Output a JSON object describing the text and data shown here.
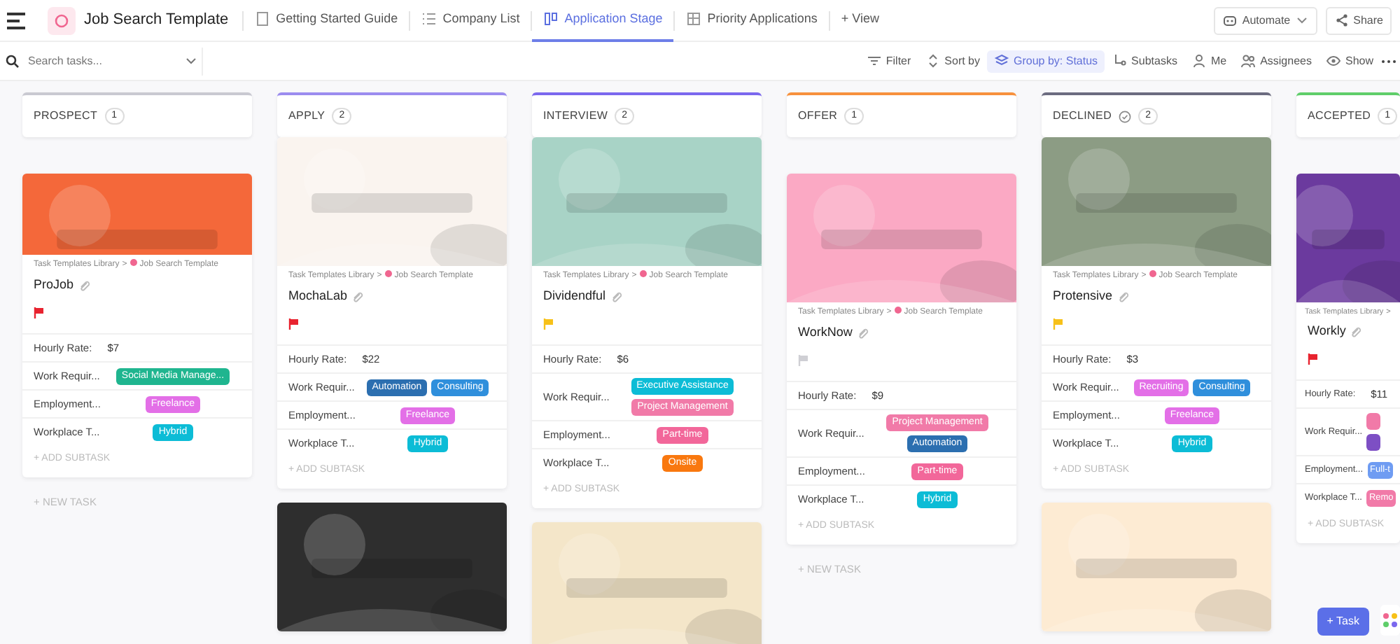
{
  "header": {
    "title": "Job Search Template"
  },
  "tabs": [
    {
      "label": "Getting Started Guide",
      "selected": false
    },
    {
      "label": "Company List",
      "selected": false
    },
    {
      "label": "Application Stage",
      "selected": true
    },
    {
      "label": "Priority Applications",
      "selected": false
    }
  ],
  "add_view": "+ View",
  "actions": [
    {
      "label": "Automate",
      "caret": true
    },
    {
      "label": "Share",
      "caret": false
    }
  ],
  "search": {
    "placeholder": "Search tasks..."
  },
  "toolbar": [
    {
      "label": "Filter",
      "selected": false
    },
    {
      "label": "Sort by",
      "selected": false
    },
    {
      "label": "Group by: Status",
      "selected": true
    },
    {
      "label": "Subtasks",
      "selected": false
    },
    {
      "label": "Me",
      "selected": false
    },
    {
      "label": "Assignees",
      "selected": false
    },
    {
      "label": "Show",
      "selected": false
    }
  ],
  "columns": [
    {
      "name": "PROSPECT",
      "count": "1",
      "color": "#c9c9d1",
      "closed": false,
      "new_task": "+ NEW TASK",
      "cards": [
        {
          "cover": {
            "kind": "picture",
            "color": "#f4683a"
          },
          "library": "Task Templates Library",
          "separator": ">",
          "template": "Job Search Template",
          "title": "ProJob",
          "flag": {
            "color": "#e8232f"
          },
          "fields": [
            {
              "label": "Hourly Rate:",
              "value": "$7"
            },
            {
              "label": "Work Requir...",
              "tags": [
                {
                  "text": "Social Media Manage...",
                  "color": "#1fb58f"
                }
              ]
            },
            {
              "label": "Employment...",
              "tags": [
                {
                  "text": "Freelance",
                  "color": "#e36fe7"
                }
              ]
            },
            {
              "label": "Workplace T...",
              "tags": [
                {
                  "text": "Hybrid",
                  "color": "#0cbcd6"
                }
              ]
            }
          ],
          "add_subtask": "+ ADD SUBTASK"
        }
      ]
    },
    {
      "name": "APPLY",
      "count": "2",
      "color": "#9b8cef",
      "closed": false,
      "cards": [
        {
          "cover": {
            "kind": "picture",
            "color": "#faf4ef"
          },
          "library": "Task Templates Library",
          "separator": ">",
          "template": "Job Search Template",
          "title": "MochaLab",
          "flag": {
            "color": "#e8232f"
          },
          "fields": [
            {
              "label": "Hourly Rate:",
              "value": "$22"
            },
            {
              "label": "Work Requir...",
              "tags": [
                {
                  "text": "Automation",
                  "color": "#2c6fb0"
                },
                {
                  "text": "Consulting",
                  "color": "#2f8fdc"
                }
              ]
            },
            {
              "label": "Employment...",
              "tags": [
                {
                  "text": "Freelance",
                  "color": "#e36fe7"
                }
              ]
            },
            {
              "label": "Workplace T...",
              "tags": [
                {
                  "text": "Hybrid",
                  "color": "#0cbcd6"
                }
              ]
            }
          ],
          "add_subtask": "+ ADD SUBTASK"
        },
        {
          "cover": {
            "kind": "picture",
            "color": "#2e2e2e"
          }
        }
      ]
    },
    {
      "name": "INTERVIEW",
      "count": "2",
      "color": "#7b68ee",
      "closed": false,
      "cards": [
        {
          "cover": {
            "kind": "picture",
            "color": "#a8d3c6"
          },
          "library": "Task Templates Library",
          "separator": ">",
          "template": "Job Search Template",
          "title": "Dividendful",
          "flag": {
            "color": "#f7c118"
          },
          "fields": [
            {
              "label": "Hourly Rate:",
              "value": "$6"
            },
            {
              "label": "Work Requir...",
              "tags": [
                {
                  "text": "Executive Assistance",
                  "color": "#0cbcd6"
                },
                {
                  "text": "Project Management",
                  "color": "#f17aa8"
                }
              ]
            },
            {
              "label": "Employment...",
              "tags": [
                {
                  "text": "Part-time",
                  "color": "#f2679a"
                }
              ]
            },
            {
              "label": "Workplace T...",
              "tags": [
                {
                  "text": "Onsite",
                  "color": "#f9780f"
                }
              ]
            }
          ],
          "add_subtask": "+ ADD SUBTASK"
        },
        {
          "cover": {
            "kind": "picture",
            "color": "#f4e6c9"
          }
        }
      ]
    },
    {
      "name": "OFFER",
      "count": "1",
      "color": "#f7913d",
      "closed": false,
      "new_task": "+ NEW TASK",
      "cards": [
        {
          "cover": {
            "kind": "picture",
            "color": "#fba9c4"
          },
          "library": "Task Templates Library",
          "separator": ">",
          "template": "Job Search Template",
          "title": "WorkNow",
          "flag": {
            "color": "#cfcfd4"
          },
          "fields": [
            {
              "label": "Hourly Rate:",
              "value": "$9"
            },
            {
              "label": "Work Requir...",
              "tags": [
                {
                  "text": "Project Management",
                  "color": "#f17aa8"
                },
                {
                  "text": "Automation",
                  "color": "#2c6fb0"
                }
              ]
            },
            {
              "label": "Employment...",
              "tags": [
                {
                  "text": "Part-time",
                  "color": "#f2679a"
                }
              ]
            },
            {
              "label": "Workplace T...",
              "tags": [
                {
                  "text": "Hybrid",
                  "color": "#0cbcd6"
                }
              ]
            }
          ],
          "add_subtask": "+ ADD SUBTASK"
        }
      ]
    },
    {
      "name": "DECLINED",
      "count": "2",
      "color": "#6c6c80",
      "closed": true,
      "cards": [
        {
          "cover": {
            "kind": "picture",
            "color": "#8c9c84"
          },
          "library": "Task Templates Library",
          "separator": ">",
          "template": "Job Search Template",
          "title": "Protensive",
          "flag": {
            "color": "#f7c118"
          },
          "fields": [
            {
              "label": "Hourly Rate:",
              "value": "$3"
            },
            {
              "label": "Work Requir...",
              "tags": [
                {
                  "text": "Recruiting",
                  "color": "#e36fe7"
                },
                {
                  "text": "Consulting",
                  "color": "#2f8fdc"
                }
              ]
            },
            {
              "label": "Employment...",
              "tags": [
                {
                  "text": "Freelance",
                  "color": "#e36fe7"
                }
              ]
            },
            {
              "label": "Workplace T...",
              "tags": [
                {
                  "text": "Hybrid",
                  "color": "#0cbcd6"
                }
              ]
            }
          ],
          "add_subtask": "+ ADD SUBTASK"
        },
        {
          "cover": {
            "kind": "picture",
            "color": "#fdebd3"
          }
        }
      ]
    },
    {
      "name": "ACCEPTED",
      "count": "1",
      "color": "#5fce6a",
      "closed": false,
      "cards": [
        {
          "cover": {
            "kind": "picture",
            "color": "#6b3a9e"
          },
          "library": "Task Templates Library",
          "separator": ">",
          "title": "Workly",
          "flag": {
            "color": "#e8232f"
          },
          "fields": [
            {
              "label": "Hourly Rate:",
              "value": "$11"
            },
            {
              "label": "Work Requir...",
              "tags": [
                {
                  "color": "#f17aa8"
                },
                {
                  "color": "#7d4fc4"
                }
              ]
            },
            {
              "label": "Employment...",
              "tags": [
                {
                  "text": "Full-t",
                  "color": "#6f9cf2"
                }
              ]
            },
            {
              "label": "Workplace T...",
              "tags": [
                {
                  "text": "Remo",
                  "color": "#f17aa8"
                }
              ]
            }
          ],
          "add_subtask": "+ ADD SUBTASK"
        }
      ]
    }
  ],
  "fab": {
    "label": "+ Task"
  }
}
